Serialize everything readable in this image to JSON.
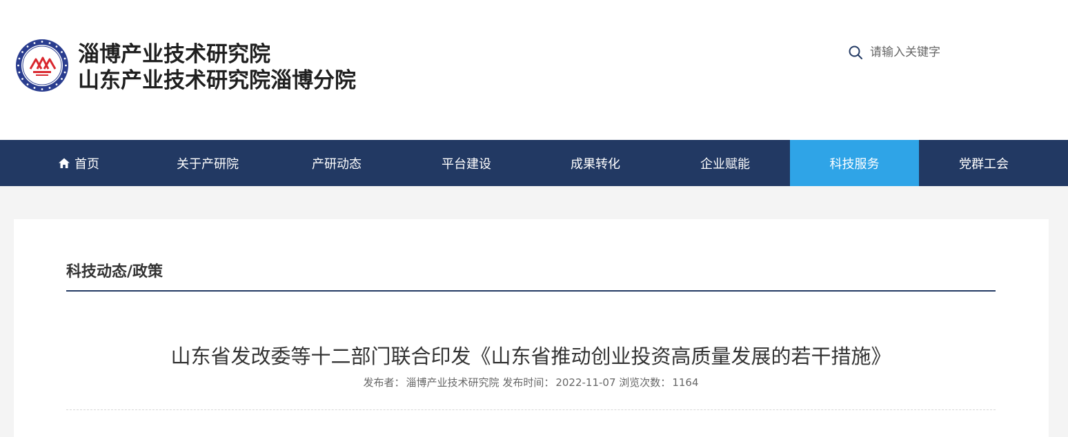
{
  "header": {
    "site_name_line1": "淄博产业技术研究院",
    "site_name_line2": "山东产业技术研究院淄博分院",
    "search_placeholder": "请输入关键字"
  },
  "nav": {
    "items": [
      {
        "label": "首页",
        "icon": "home-icon"
      },
      {
        "label": "关于产研院"
      },
      {
        "label": "产研动态"
      },
      {
        "label": "平台建设"
      },
      {
        "label": "成果转化"
      },
      {
        "label": "企业赋能"
      },
      {
        "label": "科技服务",
        "active": true
      },
      {
        "label": "党群工会"
      }
    ]
  },
  "section": {
    "title": "科技动态/政策"
  },
  "article": {
    "title": "山东省发改委等十二部门联合印发《山东省推动创业投资高质量发展的若干措施》",
    "publisher_label": "发布者：",
    "publisher": "淄博产业技术研究院",
    "date_label": "发布时间：",
    "date": "2022-11-07",
    "views_label": "浏览次数：",
    "views": "1164"
  },
  "colors": {
    "nav_bg": "#223963",
    "nav_active": "#2fa4e7",
    "logo_ring": "#2a3d8f",
    "logo_mark": "#d9272e"
  }
}
